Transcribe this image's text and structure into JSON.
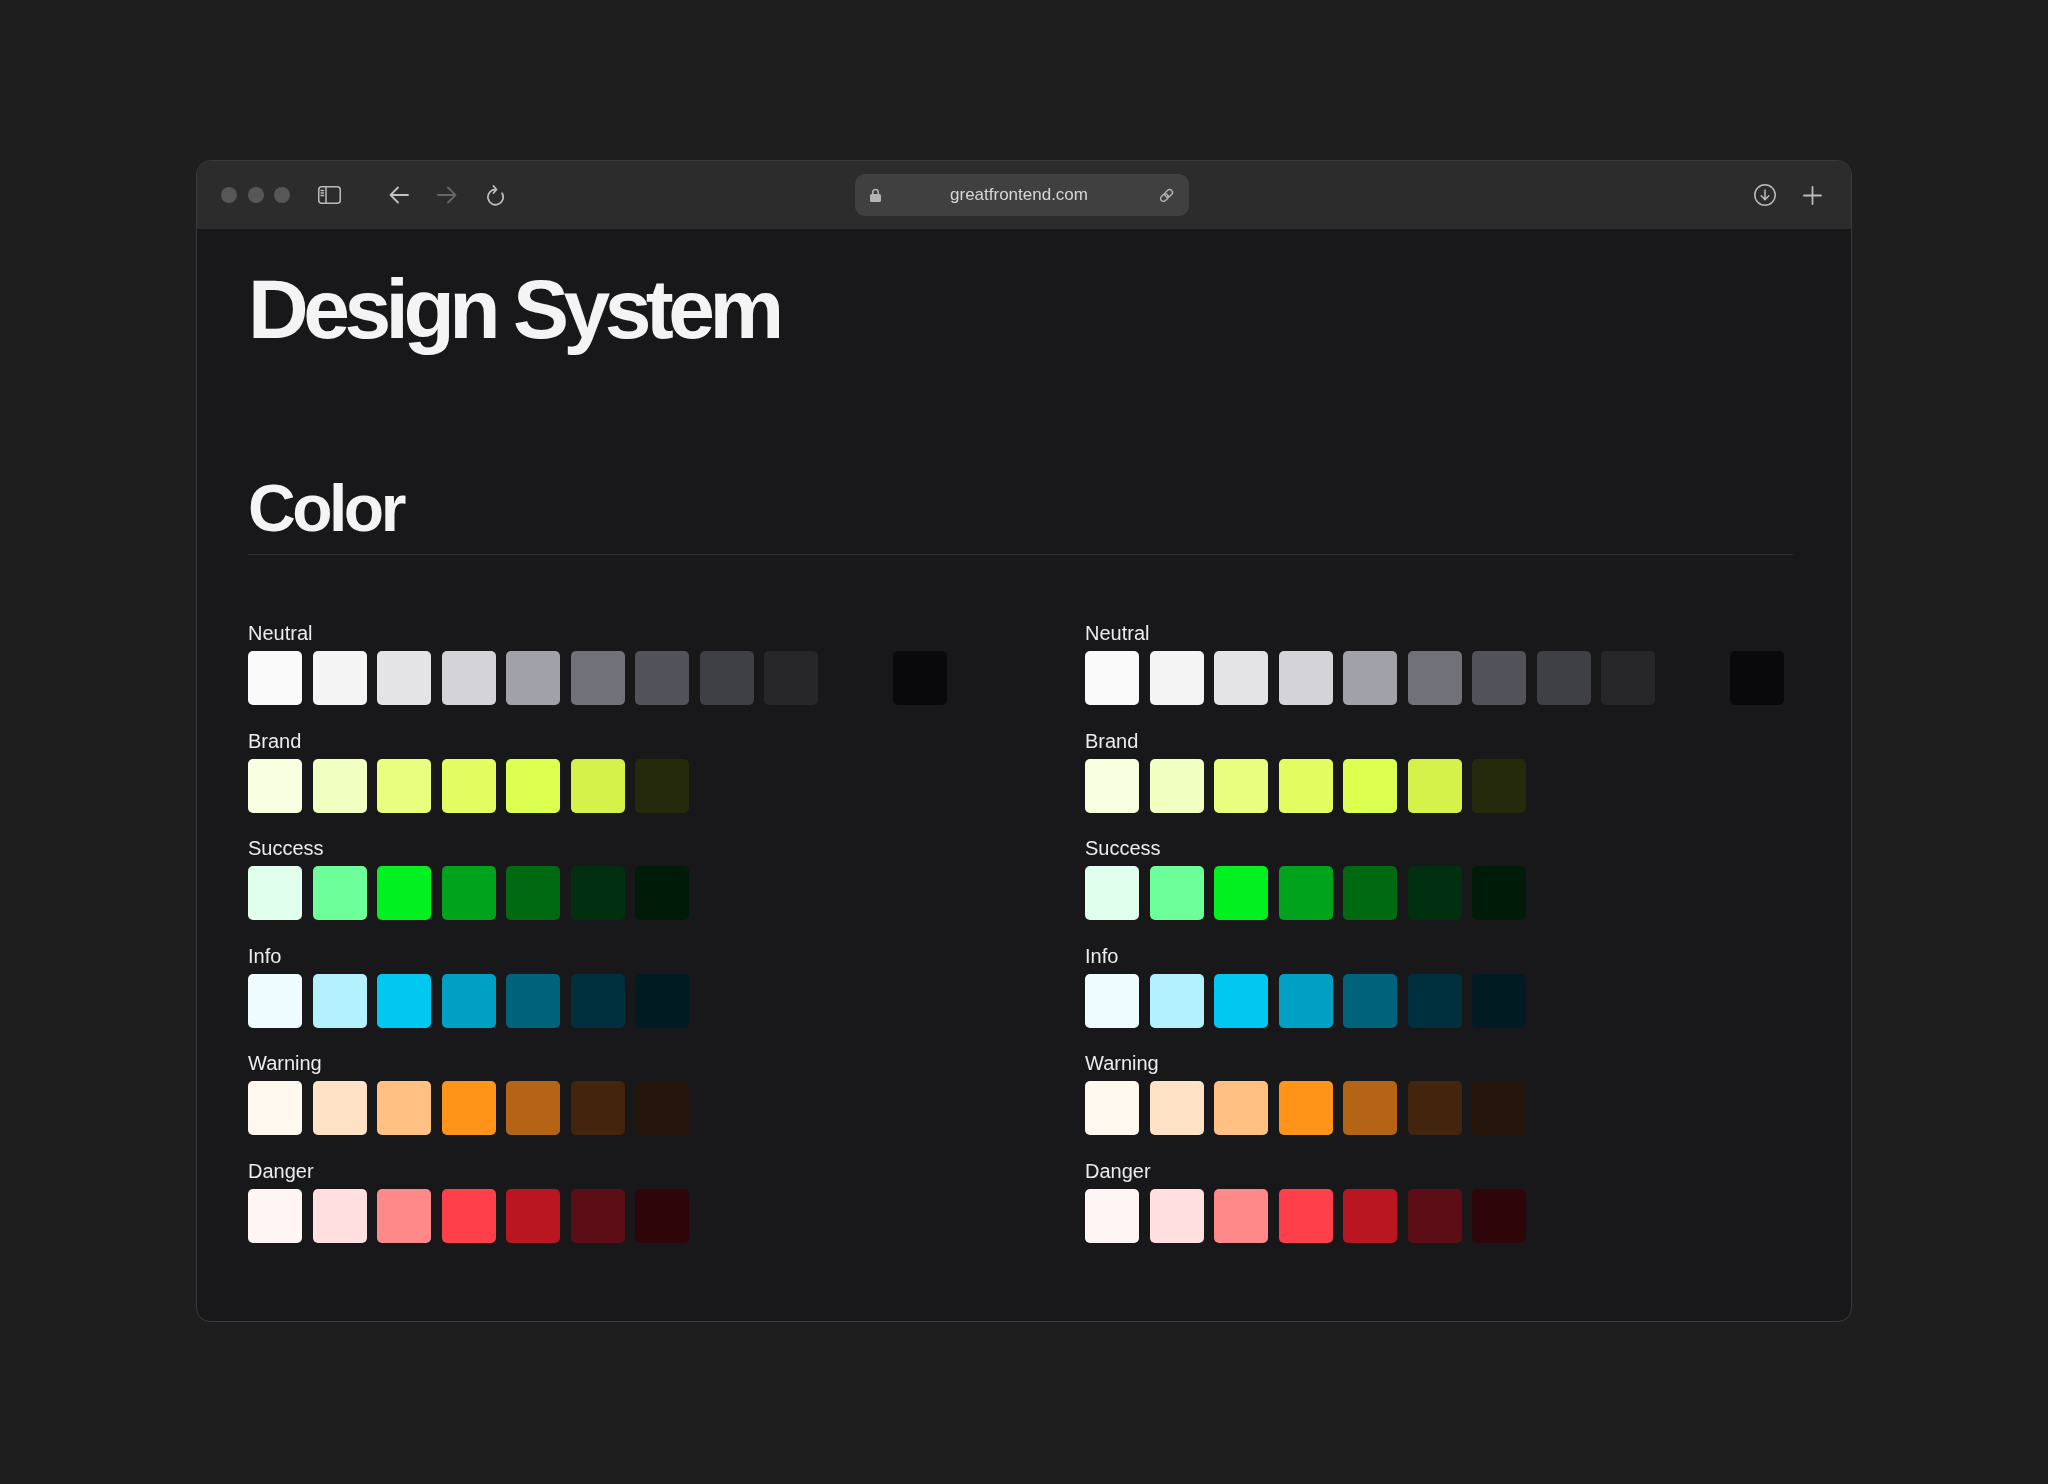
{
  "toolbar": {
    "url": "greatfrontend.com",
    "back_disabled": false,
    "forward_disabled": true
  },
  "title": "Design System",
  "section": {
    "heading": "Color",
    "palettes": [
      {
        "groups": [
          {
            "name": "Neutral",
            "swatches": [
              {
                "kind": "swatch",
                "color": "#fafafa"
              },
              {
                "kind": "swatch",
                "color": "#f4f4f5"
              },
              {
                "kind": "swatch",
                "color": "#e4e4e7"
              },
              {
                "kind": "swatch",
                "color": "#d4d4d8"
              },
              {
                "kind": "swatch",
                "color": "#a1a1aa"
              },
              {
                "kind": "swatch",
                "color": "#71717a"
              },
              {
                "kind": "swatch",
                "color": "#52525b"
              },
              {
                "kind": "swatch",
                "color": "#3f3f46"
              },
              {
                "kind": "swatch",
                "color": "#27272a"
              },
              {
                "kind": "empty"
              },
              {
                "kind": "swatch",
                "color": "#09090b"
              }
            ]
          },
          {
            "name": "Brand",
            "swatches": [
              {
                "kind": "swatch",
                "color": "#f8ffe0"
              },
              {
                "kind": "swatch",
                "color": "#f1ffc0"
              },
              {
                "kind": "swatch",
                "color": "#e9fe7e"
              },
              {
                "kind": "swatch",
                "color": "#e3fd60"
              },
              {
                "kind": "swatch",
                "color": "#dcff50"
              },
              {
                "kind": "swatch",
                "color": "#d4f24a"
              },
              {
                "kind": "swatch",
                "color": "#242a0b"
              }
            ]
          },
          {
            "name": "Success",
            "swatches": [
              {
                "kind": "swatch",
                "color": "#e0ffec"
              },
              {
                "kind": "swatch",
                "color": "#6dff9a"
              },
              {
                "kind": "swatch",
                "color": "#00f020"
              },
              {
                "kind": "swatch",
                "color": "#00a31c"
              },
              {
                "kind": "swatch",
                "color": "#006a12"
              },
              {
                "kind": "swatch",
                "color": "#003010"
              },
              {
                "kind": "swatch",
                "color": "#001c08"
              }
            ]
          },
          {
            "name": "Info",
            "swatches": [
              {
                "kind": "swatch",
                "color": "#effcff"
              },
              {
                "kind": "swatch",
                "color": "#b3f1ff"
              },
              {
                "kind": "swatch",
                "color": "#00c8f0"
              },
              {
                "kind": "swatch",
                "color": "#00a0c5"
              },
              {
                "kind": "swatch",
                "color": "#00637c"
              },
              {
                "kind": "swatch",
                "color": "#00303d"
              },
              {
                "kind": "swatch",
                "color": "#001c22"
              }
            ]
          },
          {
            "name": "Warning",
            "swatches": [
              {
                "kind": "swatch",
                "color": "#fff8ef"
              },
              {
                "kind": "swatch",
                "color": "#ffe2c6"
              },
              {
                "kind": "swatch",
                "color": "#ffc081"
              },
              {
                "kind": "swatch",
                "color": "#ff9418"
              },
              {
                "kind": "swatch",
                "color": "#b46414"
              },
              {
                "kind": "swatch",
                "color": "#42250c"
              },
              {
                "kind": "swatch",
                "color": "#251409"
              }
            ]
          },
          {
            "name": "Danger",
            "swatches": [
              {
                "kind": "swatch",
                "color": "#fff5f5"
              },
              {
                "kind": "swatch",
                "color": "#ffdfdf"
              },
              {
                "kind": "swatch",
                "color": "#ff8888"
              },
              {
                "kind": "swatch",
                "color": "#ff404a"
              },
              {
                "kind": "swatch",
                "color": "#ba1622"
              },
              {
                "kind": "swatch",
                "color": "#5c0d15"
              },
              {
                "kind": "swatch",
                "color": "#2e060a"
              }
            ]
          }
        ]
      },
      {
        "groups": [
          {
            "name": "Neutral",
            "swatches": [
              {
                "kind": "swatch",
                "color": "#fafafa"
              },
              {
                "kind": "swatch",
                "color": "#f4f4f5"
              },
              {
                "kind": "swatch",
                "color": "#e4e4e7"
              },
              {
                "kind": "swatch",
                "color": "#d4d4d8"
              },
              {
                "kind": "swatch",
                "color": "#a1a1aa"
              },
              {
                "kind": "swatch",
                "color": "#71717a"
              },
              {
                "kind": "swatch",
                "color": "#52525b"
              },
              {
                "kind": "swatch",
                "color": "#3f3f46"
              },
              {
                "kind": "swatch",
                "color": "#27272a"
              },
              {
                "kind": "empty"
              },
              {
                "kind": "swatch",
                "color": "#09090b"
              }
            ]
          },
          {
            "name": "Brand",
            "swatches": [
              {
                "kind": "swatch",
                "color": "#f8ffe0"
              },
              {
                "kind": "swatch",
                "color": "#f1ffc0"
              },
              {
                "kind": "swatch",
                "color": "#e9fe7e"
              },
              {
                "kind": "swatch",
                "color": "#e3fd60"
              },
              {
                "kind": "swatch",
                "color": "#dcff50"
              },
              {
                "kind": "swatch",
                "color": "#d4f24a"
              },
              {
                "kind": "swatch",
                "color": "#242a0b"
              }
            ]
          },
          {
            "name": "Success",
            "swatches": [
              {
                "kind": "swatch",
                "color": "#e0ffec"
              },
              {
                "kind": "swatch",
                "color": "#6dff9a"
              },
              {
                "kind": "swatch",
                "color": "#00f020"
              },
              {
                "kind": "swatch",
                "color": "#00a31c"
              },
              {
                "kind": "swatch",
                "color": "#006a12"
              },
              {
                "kind": "swatch",
                "color": "#003010"
              },
              {
                "kind": "swatch",
                "color": "#001c08"
              }
            ]
          },
          {
            "name": "Info",
            "swatches": [
              {
                "kind": "swatch",
                "color": "#effcff"
              },
              {
                "kind": "swatch",
                "color": "#b3f1ff"
              },
              {
                "kind": "swatch",
                "color": "#00c8f0"
              },
              {
                "kind": "swatch",
                "color": "#00a0c5"
              },
              {
                "kind": "swatch",
                "color": "#00637c"
              },
              {
                "kind": "swatch",
                "color": "#00303d"
              },
              {
                "kind": "swatch",
                "color": "#001c22"
              }
            ]
          },
          {
            "name": "Warning",
            "swatches": [
              {
                "kind": "swatch",
                "color": "#fff8ef"
              },
              {
                "kind": "swatch",
                "color": "#ffe2c6"
              },
              {
                "kind": "swatch",
                "color": "#ffc081"
              },
              {
                "kind": "swatch",
                "color": "#ff9418"
              },
              {
                "kind": "swatch",
                "color": "#b46414"
              },
              {
                "kind": "swatch",
                "color": "#42250c"
              },
              {
                "kind": "swatch",
                "color": "#251409"
              }
            ]
          },
          {
            "name": "Danger",
            "swatches": [
              {
                "kind": "swatch",
                "color": "#fff5f5"
              },
              {
                "kind": "swatch",
                "color": "#ffdfdf"
              },
              {
                "kind": "swatch",
                "color": "#ff8888"
              },
              {
                "kind": "swatch",
                "color": "#ff404a"
              },
              {
                "kind": "swatch",
                "color": "#ba1622"
              },
              {
                "kind": "swatch",
                "color": "#5c0d15"
              },
              {
                "kind": "swatch",
                "color": "#2e060a"
              }
            ]
          }
        ]
      }
    ]
  }
}
